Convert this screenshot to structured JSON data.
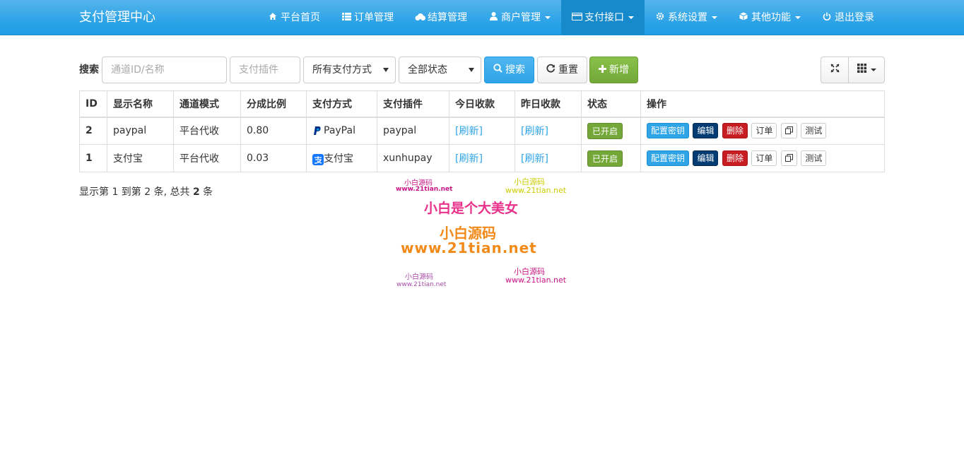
{
  "navbar": {
    "brand": "支付管理中心",
    "items": [
      {
        "label": "平台首页",
        "icon": "home-icon",
        "dropdown": false
      },
      {
        "label": "订单管理",
        "icon": "list-icon",
        "dropdown": false
      },
      {
        "label": "结算管理",
        "icon": "cloud-icon",
        "dropdown": false
      },
      {
        "label": "商户管理",
        "icon": "user-icon",
        "dropdown": true
      },
      {
        "label": "支付接口",
        "icon": "credit-card-icon",
        "dropdown": true,
        "active": true
      },
      {
        "label": "系统设置",
        "icon": "gear-icon",
        "dropdown": true
      },
      {
        "label": "其他功能",
        "icon": "cube-icon",
        "dropdown": true
      },
      {
        "label": "退出登录",
        "icon": "power-icon",
        "dropdown": false
      }
    ]
  },
  "toolbar": {
    "search_label": "搜索",
    "channel_placeholder": "通道ID/名称",
    "plugin_placeholder": "支付插件",
    "pay_type_value": "所有支付方式",
    "status_value": "全部状态",
    "search_button": "搜索",
    "reset_button": "重置",
    "add_button": "新增"
  },
  "table": {
    "headers": [
      "ID",
      "显示名称",
      "通道模式",
      "分成比例",
      "支付方式",
      "支付插件",
      "今日收款",
      "昨日收款",
      "状态",
      "操作"
    ],
    "rows": [
      {
        "id": "2",
        "name": "paypal",
        "mode": "平台代收",
        "ratio": "0.80",
        "pay_type": "PayPal",
        "pay_icon": "paypal-icon",
        "plugin": "paypal",
        "today": "[刷新]",
        "yesterday": "[刷新]",
        "status": "已开启"
      },
      {
        "id": "1",
        "name": "支付宝",
        "mode": "平台代收",
        "ratio": "0.03",
        "pay_type": "支付宝",
        "pay_icon": "alipay-icon",
        "plugin": "xunhupay",
        "today": "[刷新]",
        "yesterday": "[刷新]",
        "status": "已开启"
      }
    ],
    "actions": {
      "config": "配置密钥",
      "edit": "编辑",
      "delete": "删除",
      "orders": "订单",
      "copy_icon": "copy-icon",
      "test": "测试"
    }
  },
  "pagination": {
    "info_prefix": "显示第 1 到第 2 条, 总共 ",
    "total": "2",
    "info_suffix": " 条"
  },
  "watermark": {
    "small_a": "小白源码",
    "url_a": "www.21tian.net",
    "headline": "小白是个大美女",
    "big_name": "小白源码",
    "big_url": "www.21tian.net"
  },
  "colors": {
    "navbar": "#2fa4e7",
    "primary": "#2fa4e7",
    "success": "#73a839",
    "danger": "#c71c22",
    "dark": "#033c73"
  }
}
